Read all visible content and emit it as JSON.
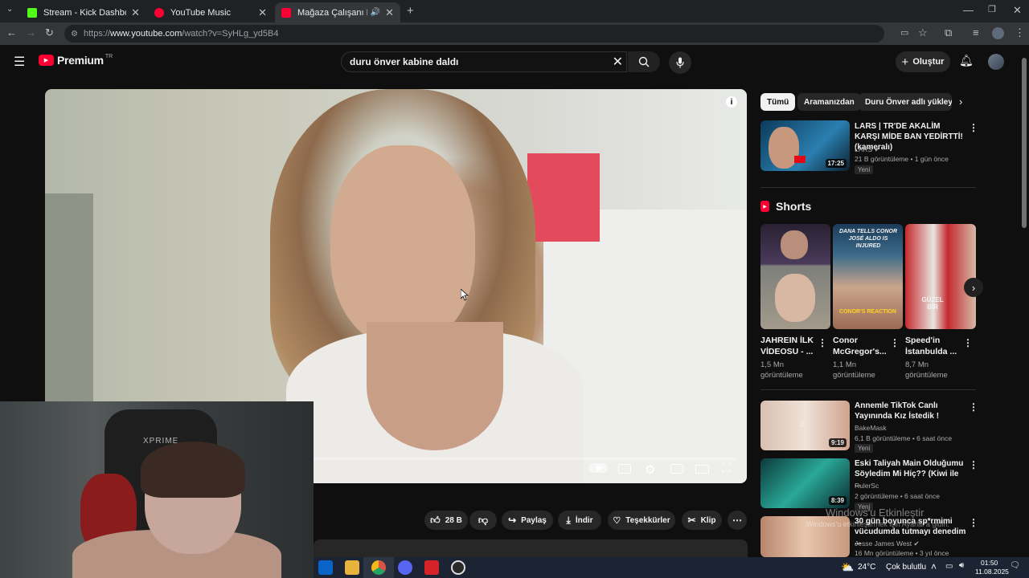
{
  "browser": {
    "tabs": [
      {
        "title": "Stream - Kick Dashboard",
        "active": false,
        "favicon_color": "#53fc18"
      },
      {
        "title": "YouTube Music",
        "active": false,
        "favicon_color": "#ff0033"
      },
      {
        "title": "Mağaza Çalışanı Kabine Gi",
        "active": true,
        "favicon_color": "#ff0033"
      }
    ],
    "url_prefix": "https://",
    "url_domain": "www.youtube.com",
    "url_path": "/watch?v=SyHLg_yd5B4"
  },
  "youtube": {
    "logo_text": "Premium",
    "region": "TR",
    "search_value": "duru önver kabine daldı",
    "create_label": "Oluştur"
  },
  "actions": {
    "likes": "28 B",
    "share": "Paylaş",
    "download": "İndir",
    "thanks": "Teşekkürler",
    "clip": "Klip"
  },
  "sidebar": {
    "chips": [
      "Tümü",
      "Aramanızdan",
      "Duru Önver adlı yükleyic"
    ],
    "top_videos": [
      {
        "title": "LARS | TR'DE AKALİM KARŞI MİDE BAN YEDİRTTİ! (kameralı)",
        "channel": "LARS",
        "meta": "21 B görüntüleme • 1 gün önce",
        "badge": "Yeni",
        "duration": "17:25"
      }
    ],
    "shorts_heading": "Shorts",
    "shorts": [
      {
        "title": "JAHREIN İLK VİDEOSU - ...",
        "views": "1,5 Mn",
        "views_label": "görüntüleme",
        "overlay": ""
      },
      {
        "title": "Conor McGregor's...",
        "views": "1,1 Mn",
        "views_label": "görüntüleme",
        "overlay": "DANA TELLS CONOR JOSÉ ALDO IS INJURED",
        "overlay2": "CONOR'S REACTION"
      },
      {
        "title": "Speed'in İstanbulda ...",
        "views": "8,7 Mn",
        "views_label": "görüntüleme",
        "overlay": "GÜZEL BİR"
      }
    ],
    "videos": [
      {
        "title": "Annemle TikTok Canlı Yayınında Kız İstedik !",
        "channel": "BakeMask",
        "meta": "6,1 B görüntüleme • 6 saat önce",
        "badge": "Yeni",
        "duration": "9:19"
      },
      {
        "title": "Eski Taliyah Main Olduğumu Söyledim Mi Hiç?? (Kiwi ile ...",
        "channel": "RulerSc",
        "meta": "2 görüntüleme • 6 saat önce",
        "badge": "Yeni",
        "duration": "8:39"
      },
      {
        "title": "30 gün boyunca sp*rmimi vücudumda tutmayı denedim ...",
        "channel": "Jesse James West",
        "meta": "16 Mn görüntüleme • 3 yıl önce",
        "badge": "",
        "duration": ""
      }
    ]
  },
  "webcam": {
    "chair_brand": "XPRIME"
  },
  "windows_watermark": {
    "line1": "Windows'u Etkinleştir",
    "line2": "Windows'u etkinleştirmek için Ayarlar'a gidin."
  },
  "taskbar": {
    "weather_temp": "24°C",
    "weather_desc": "Çok bulutlu",
    "time": "01:50",
    "date": "11.08.2025"
  }
}
